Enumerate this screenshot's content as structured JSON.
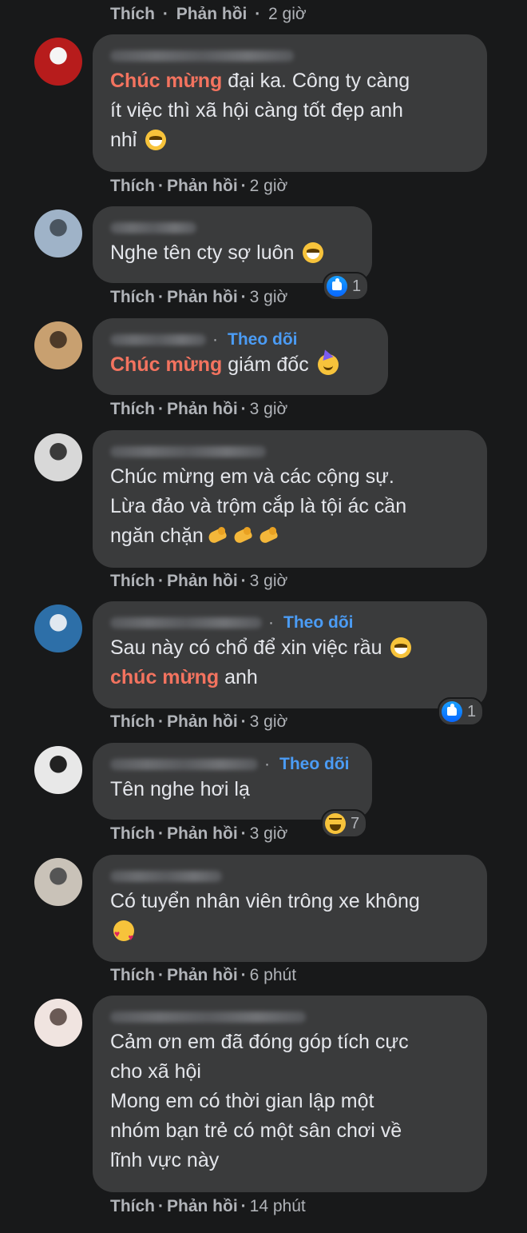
{
  "actions": {
    "like": "Thích",
    "reply": "Phản hồi",
    "sep": "·"
  },
  "top_time": "2 giờ",
  "comments": [
    {
      "segments": [
        {
          "type": "hl",
          "text": "Chúc mừng"
        },
        {
          "type": "t",
          "text": " đại ka. Công ty càng"
        },
        {
          "type": "br"
        },
        {
          "type": "t",
          "text": "ít việc thì xã hội càng tốt đẹp anh"
        },
        {
          "type": "br"
        },
        {
          "type": "t",
          "text": "nhỉ "
        },
        {
          "type": "emoji",
          "name": "grin"
        }
      ],
      "time": "2 giờ",
      "avatar_colors": [
        "#b71c1c",
        "#f5f5f5"
      ]
    },
    {
      "segments": [
        {
          "type": "t",
          "text": "Nghe tên cty sợ luôn "
        },
        {
          "type": "emoji",
          "name": "grin"
        }
      ],
      "reaction": {
        "icon": "like",
        "count": "1"
      },
      "time": "3 giờ",
      "avatar_colors": [
        "#9fb3c8",
        "#4a5560"
      ]
    },
    {
      "follow": "Theo dõi",
      "segments": [
        {
          "type": "hl",
          "text": "Chúc mừng"
        },
        {
          "type": "t",
          "text": " giám đốc "
        },
        {
          "type": "emoji",
          "name": "party"
        }
      ],
      "time": "3 giờ",
      "avatar_colors": [
        "#c8a070",
        "#4d3a28"
      ]
    },
    {
      "segments": [
        {
          "type": "t",
          "text": "Chúc mừng em và các cộng sự."
        },
        {
          "type": "br"
        },
        {
          "type": "t",
          "text": "Lừa đảo và trộm cắp là tội ác cần"
        },
        {
          "type": "br"
        },
        {
          "type": "t",
          "text": "ngăn chặn"
        },
        {
          "type": "emoji",
          "name": "muscle"
        },
        {
          "type": "emoji",
          "name": "muscle"
        },
        {
          "type": "emoji",
          "name": "muscle"
        }
      ],
      "time": "3 giờ",
      "avatar_colors": [
        "#d8d8d8",
        "#3a3a3a"
      ]
    },
    {
      "follow": "Theo dõi",
      "segments": [
        {
          "type": "t",
          "text": "Sau này có chổ để xin việc rầu "
        },
        {
          "type": "emoji",
          "name": "grin"
        },
        {
          "type": "br"
        },
        {
          "type": "hl",
          "text": "chúc mừng"
        },
        {
          "type": "t",
          "text": " anh"
        }
      ],
      "reaction": {
        "icon": "like",
        "count": "1"
      },
      "time": "3 giờ",
      "avatar_colors": [
        "#2d6fa8",
        "#e0e8f0"
      ]
    },
    {
      "follow": "Theo dõi",
      "segments": [
        {
          "type": "t",
          "text": "Tên nghe hơi lạ"
        }
      ],
      "reaction": {
        "icon": "haha",
        "count": "7"
      },
      "time": "3 giờ",
      "avatar_colors": [
        "#e8e8e8",
        "#222222"
      ]
    },
    {
      "segments": [
        {
          "type": "t",
          "text": "Có tuyển nhân viên trông xe không"
        },
        {
          "type": "br"
        },
        {
          "type": "emoji",
          "name": "love"
        }
      ],
      "time": "6 phút",
      "avatar_colors": [
        "#c9c2b8",
        "#555555"
      ]
    },
    {
      "segments": [
        {
          "type": "t",
          "text": "Cảm ơn em đã đóng góp tích cực"
        },
        {
          "type": "br"
        },
        {
          "type": "t",
          "text": "cho xã hội"
        },
        {
          "type": "br"
        },
        {
          "type": "t",
          "text": "Mong em có thời gian lập một"
        },
        {
          "type": "br"
        },
        {
          "type": "t",
          "text": "nhóm bạn trẻ có một sân chơi về"
        },
        {
          "type": "br"
        },
        {
          "type": "t",
          "text": "lĩnh vực này"
        }
      ],
      "time": "14 phút",
      "avatar_colors": [
        "#f0e4e0",
        "#6a5a55"
      ]
    }
  ]
}
